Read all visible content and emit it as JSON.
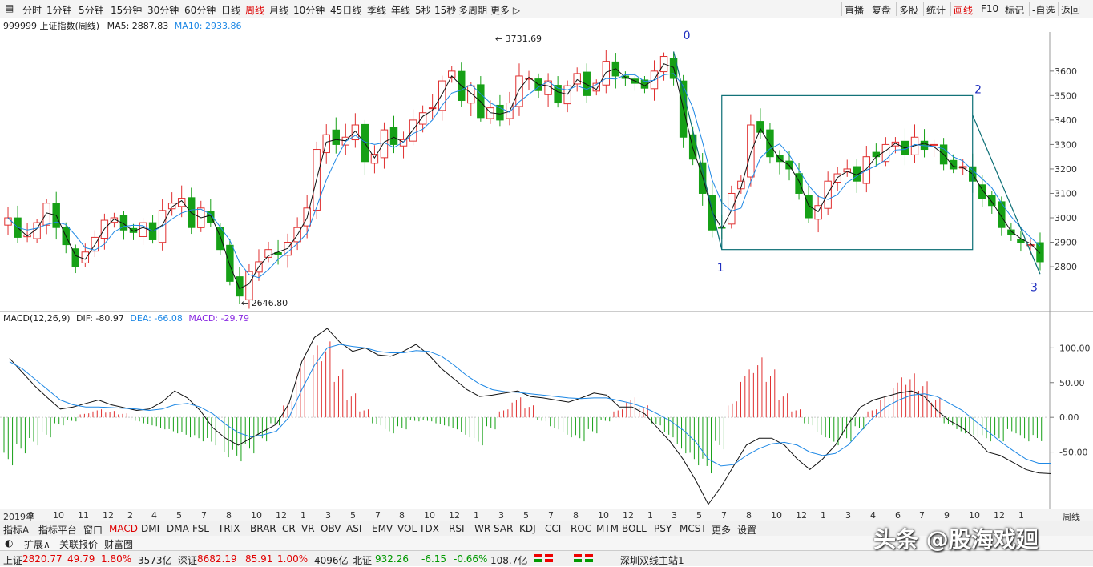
{
  "period_tabs": [
    "分时",
    "1分钟",
    "5分钟",
    "15分钟",
    "30分钟",
    "60分钟",
    "日线",
    "周线",
    "月线",
    "10分钟",
    "45日线",
    "季线",
    "年线",
    "5秒",
    "15秒",
    "多周期",
    "更多 ▷"
  ],
  "active_period": "周线",
  "right_tools": [
    "直播",
    "复盘",
    "多股",
    "统计",
    "画线",
    "F10",
    "标记",
    "-自选",
    "返回"
  ],
  "active_tool": "画线",
  "info": {
    "title": "999999 上证指数(周线)",
    "ma5": "MA5: 2887.83",
    "ma10": "MA10: 2933.86"
  },
  "macd_info": {
    "name": "MACD(12,26,9)",
    "dif": "DIF: -80.97",
    "dea": "DEA: -66.08",
    "macd": "MACD: -29.79"
  },
  "colors": {
    "up": "#e03030",
    "down": "#16a016",
    "ma5": "#111111",
    "ma10": "#1e88e5",
    "line": "#0b6e75",
    "label": "#1f2fbf",
    "macd_text": "#8a2be2"
  },
  "annotations": {
    "high": "3731.69",
    "low": "2646.80",
    "p0": "0",
    "p1": "1",
    "p2": "2",
    "p3": "3"
  },
  "chart_data": [
    {
      "type": "candlestick",
      "title": "999999 上证指数(周线)",
      "y_ticks": [
        "3600",
        "3500",
        "3400",
        "3300",
        "3200",
        "3100",
        "3000",
        "2900",
        "2800"
      ],
      "ylim": [
        2620,
        3760
      ],
      "x_labels": [
        "2019年",
        "9",
        "10",
        "11",
        "12",
        "2",
        "4",
        "5",
        "7",
        "8",
        "10",
        "12",
        "1",
        "3",
        "5",
        "7",
        "8",
        "10",
        "12",
        "1",
        "3",
        "5",
        "7",
        "8",
        "10",
        "12",
        "1",
        "3",
        "5",
        "7",
        "8",
        "10",
        "12",
        "1",
        "3",
        "4",
        "6",
        "7",
        "9",
        "10",
        "12",
        "1"
      ],
      "close_path": [
        3000,
        2920,
        2930,
        2980,
        3060,
        2960,
        2890,
        2800,
        2860,
        2920,
        2990,
        3000,
        2950,
        2940,
        2980,
        2910,
        3030,
        3060,
        3080,
        2960,
        3040,
        2980,
        2870,
        2740,
        2680,
        2780,
        2820,
        2870,
        2850,
        2900,
        2960,
        3040,
        3280,
        3340,
        3300,
        3330,
        3380,
        3230,
        3260,
        3360,
        3300,
        3320,
        3400,
        3430,
        3450,
        3560,
        3600,
        3480,
        3540,
        3410,
        3450,
        3400,
        3470,
        3580,
        3570,
        3520,
        3560,
        3470,
        3540,
        3590,
        3500,
        3550,
        3640,
        3580,
        3570,
        3550,
        3530,
        3600,
        3660,
        3570,
        3330,
        3240,
        3100,
        2950,
        2960,
        3100,
        3150,
        3380,
        3350,
        3250,
        3230,
        3200,
        3100,
        3000,
        3050,
        3150,
        3180,
        3200,
        3150,
        3250,
        3250,
        3300,
        3310,
        3260,
        3330,
        3280,
        3300,
        3220,
        3200,
        3210,
        3150,
        3080,
        3050,
        2960,
        2930,
        2900,
        2890,
        2820
      ],
      "ma5_range": "2887.83",
      "ma10_range": "2933.86"
    },
    {
      "type": "bar",
      "title": "MACD(12,26,9)",
      "y_ticks": [
        "100.00",
        "50.00",
        "0.00",
        "-50.00"
      ],
      "ylim": [
        -130,
        135
      ],
      "dif_path": [
        85,
        65,
        45,
        28,
        12,
        15,
        20,
        25,
        18,
        14,
        10,
        12,
        22,
        38,
        28,
        10,
        -15,
        -30,
        -40,
        -30,
        -20,
        -10,
        20,
        80,
        115,
        128,
        108,
        95,
        100,
        90,
        88,
        95,
        105,
        90,
        70,
        55,
        40,
        30,
        32,
        35,
        38,
        30,
        28,
        25,
        22,
        28,
        35,
        32,
        15,
        15,
        5,
        -15,
        -35,
        -60,
        -90,
        -125,
        -100,
        -70,
        -40,
        -30,
        -30,
        -40,
        -60,
        -75,
        -60,
        -40,
        -10,
        15,
        25,
        30,
        35,
        38,
        30,
        10,
        -5,
        -15,
        -30,
        -50,
        -55,
        -65,
        -75,
        -80,
        -81
      ],
      "dea_path": [
        80,
        70,
        55,
        40,
        25,
        18,
        15,
        15,
        14,
        13,
        12,
        10,
        12,
        18,
        20,
        15,
        5,
        -10,
        -22,
        -28,
        -25,
        -20,
        0,
        40,
        75,
        100,
        105,
        102,
        100,
        95,
        93,
        93,
        96,
        95,
        88,
        75,
        60,
        48,
        40,
        37,
        36,
        34,
        32,
        30,
        28,
        27,
        28,
        28,
        24,
        20,
        14,
        5,
        -5,
        -18,
        -35,
        -60,
        -70,
        -68,
        -55,
        -45,
        -38,
        -36,
        -40,
        -50,
        -55,
        -52,
        -40,
        -20,
        0,
        15,
        25,
        32,
        34,
        30,
        20,
        10,
        -5,
        -20,
        -35,
        -48,
        -60,
        -66,
        -66.08
      ],
      "macd_path": [
        -60,
        -45,
        -35,
        -25,
        -10,
        -5,
        5,
        10,
        8,
        5,
        -5,
        -10,
        -15,
        -20,
        -25,
        -30,
        -35,
        -50,
        -55,
        -45,
        -30,
        -10,
        20,
        75,
        90,
        95,
        60,
        30,
        10,
        -10,
        -20,
        -15,
        -5,
        -5,
        -10,
        -15,
        -25,
        -35,
        -15,
        10,
        25,
        15,
        -5,
        -15,
        -25,
        -30,
        -20,
        -5,
        10,
        25,
        15,
        -10,
        -25,
        -45,
        -60,
        -70,
        -40,
        20,
        60,
        75,
        60,
        30,
        10,
        -10,
        -25,
        -35,
        -30,
        -15,
        10,
        30,
        50,
        55,
        45,
        25,
        -10,
        -20,
        -25,
        -30,
        -30,
        -20,
        -30,
        -29.79
      ]
    }
  ],
  "axis_right_label": "周线",
  "indicators": [
    "指标A",
    "指标平台",
    "窗口",
    "MACD",
    "DMI",
    "DMA",
    "FSL",
    "TRIX",
    "BRAR",
    "CR",
    "VR",
    "OBV",
    "ASI",
    "EMV",
    "VOL-TDX",
    "RSI",
    "WR",
    "SAR",
    "KDJ",
    "CCI",
    "ROC",
    "MTM",
    "BOLL",
    "PSY",
    "MCST",
    "更多",
    "设置"
  ],
  "active_indicator": "MACD",
  "sub_tabs": [
    "扩展∧",
    "关联报价",
    "财富圈"
  ],
  "status": {
    "sh_label": "上证",
    "sh_price": "2820.77",
    "sh_chg": "49.79",
    "sh_pct": "1.80%",
    "sh_amt": "3573亿",
    "sz_label": "深证",
    "sz_price": "8682.19",
    "sz_chg": "85.91",
    "sz_pct": "1.00%",
    "sz_amt": "4096亿",
    "nb_label": "北证",
    "nb_price": "932.26",
    "nb_chg": "-6.15",
    "nb_pct": "-0.66%",
    "nb_amt": "108.7亿",
    "station": "深圳双线主站1"
  },
  "watermark": "头条 @股海戏廻"
}
